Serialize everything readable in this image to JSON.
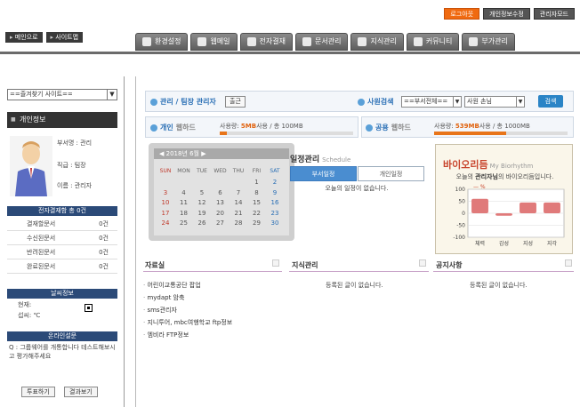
{
  "header": {
    "util_buttons": [
      "로그아웃",
      "개인정보수정",
      "관리자모드"
    ],
    "quick_links": [
      "메인으로",
      "사이트맵"
    ],
    "nav_tabs": [
      "환경설정",
      "웹메일",
      "전자결재",
      "문서관리",
      "지식관리",
      "커뮤니티",
      "부가관리"
    ]
  },
  "sidebar": {
    "favorites_select": "==즐겨찾기 사이트==",
    "profile_title": "개인정보",
    "profile": {
      "dept": "부서명 : 관리",
      "rank": "직급 : 팀장",
      "name": "이름 : 관리자"
    },
    "approval_title": "전자결재함 총 0건",
    "approval_rows": [
      {
        "name": "결재할문서",
        "count": "0건"
      },
      {
        "name": "수신된문서",
        "count": "0건"
      },
      {
        "name": "반려된문서",
        "count": "0건"
      },
      {
        "name": "완료된문서",
        "count": "0건"
      }
    ],
    "weather_title": "날씨정보",
    "weather_current": "현재:",
    "weather_temp": "섭씨: ℃",
    "poll_title": "온라인설문",
    "poll_question": "Q : 그룹웨어를 개통합니다 테스트해보시고 평가해주세요",
    "poll_vote": "투표하기",
    "poll_result": "결과보기"
  },
  "main": {
    "admin_label": "관리 / 팀장 관리자",
    "checkin_button": "출근",
    "staff_search_label": "사원검색",
    "dept_select": "==부서전체==",
    "staff_select": "사원 손님",
    "search_button": "검색",
    "personal_webhard_a": "개인",
    "personal_webhard_b": "웹하드",
    "personal_usage_label": "사용량:",
    "personal_usage_used": "5MB",
    "personal_usage_rest": "사용 / 총 100MB",
    "personal_usage_fraction": 0.05,
    "shared_webhard_a": "공용",
    "shared_webhard_b": "웹하드",
    "shared_usage_label": "사용량:",
    "shared_usage_used": "539MB",
    "shared_usage_rest": "사용 / 총 1000MB",
    "shared_usage_fraction": 0.539,
    "calendar": {
      "month_label": "2018년 6월",
      "weekdays": [
        "SUN",
        "MON",
        "TUE",
        "WED",
        "THU",
        "FRI",
        "SAT"
      ],
      "weeks": [
        [
          "",
          "",
          "",
          "",
          "",
          "1",
          "2"
        ],
        [
          "3",
          "4",
          "5",
          "6",
          "7",
          "8",
          "9"
        ],
        [
          "10",
          "11",
          "12",
          "13",
          "14",
          "15",
          "16"
        ],
        [
          "17",
          "18",
          "19",
          "20",
          "21",
          "22",
          "23"
        ],
        [
          "24",
          "25",
          "26",
          "27",
          "28",
          "29",
          "30"
        ]
      ]
    },
    "schedule_title": "일정관리",
    "schedule_title_en": "Schedule",
    "schedule_tab_dept": "부서일정",
    "schedule_tab_personal": "개인일정",
    "schedule_empty": "오늘의 일정이 없습니다.",
    "bio_title": "바이오리듬",
    "bio_title_en": "My Biorhythm",
    "bio_msg_pre": "오늘의 ",
    "bio_msg_name": "관리자님",
    "bio_msg_post": "의 바이오리듬입니다.",
    "library_title": "자료실",
    "library_items": [
      "어린이교통공단 팝업",
      "mydapt 암축",
      "sms관리자",
      "지니투어, mbc여행학교 ftp정보",
      "엠비라 FTP정보"
    ],
    "knowledge_title": "지식관리",
    "knowledge_empty": "등록된 글이 없습니다.",
    "notice_title": "공지사항",
    "notice_empty": "등록된 글이 없습니다."
  },
  "chart_data": {
    "type": "bar",
    "title": "",
    "unit_label": "%",
    "categories": [
      "체력",
      "감성",
      "지성",
      "지각"
    ],
    "values": [
      60,
      -10,
      45,
      45
    ],
    "ylim": [
      -100,
      100
    ],
    "yticks": [
      "100",
      "50",
      "0",
      "-50",
      "-100"
    ]
  }
}
